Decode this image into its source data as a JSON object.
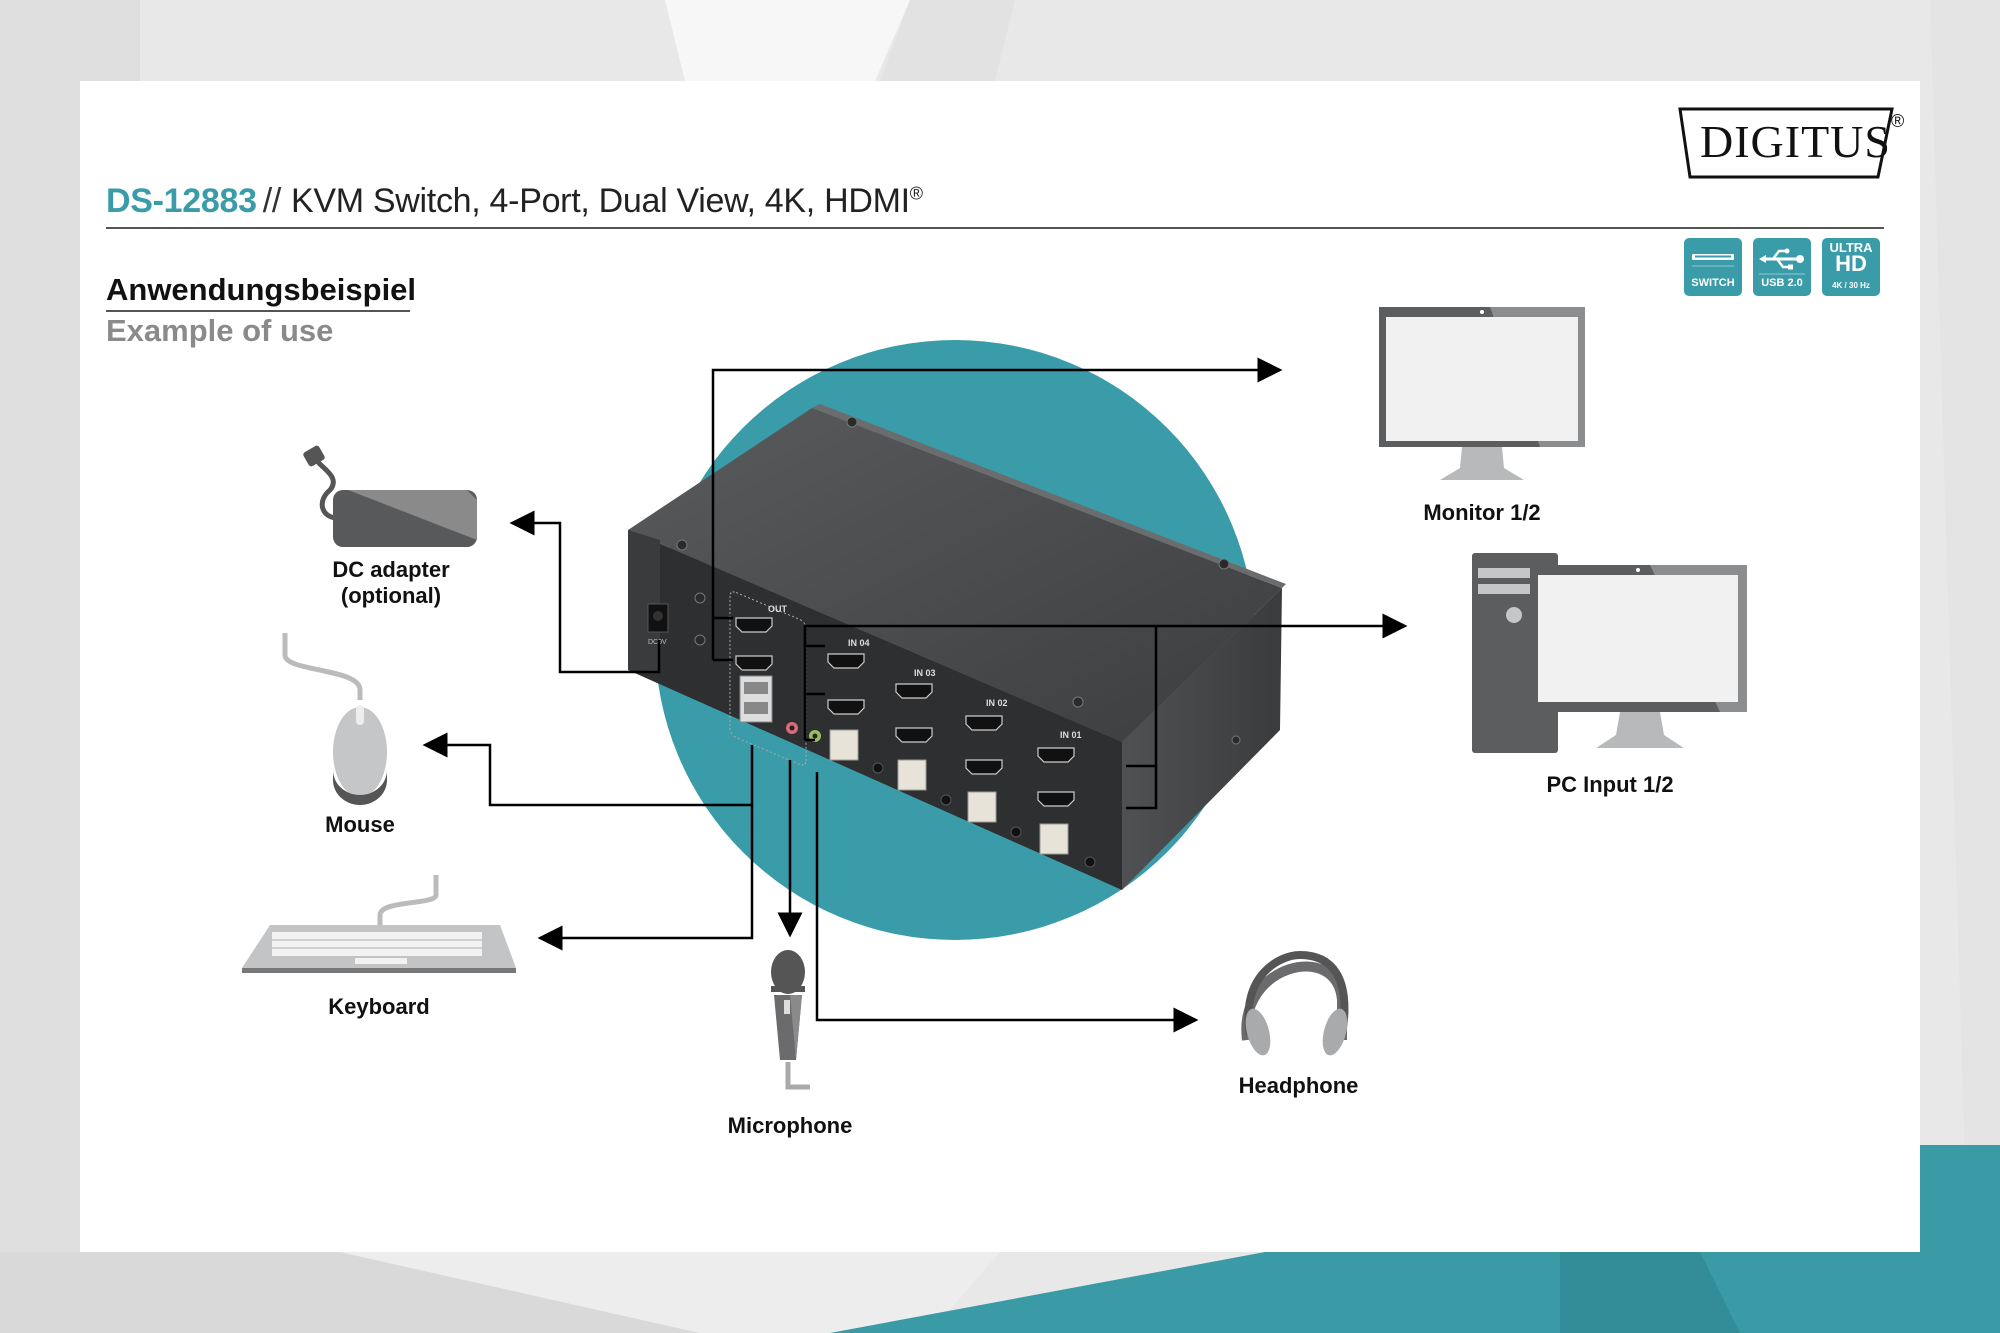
{
  "brand": {
    "logo_text": "DIGITUS",
    "logo_mark": "®",
    "accent_color": "#3a9ca8"
  },
  "header": {
    "sku": "DS-12883",
    "separator": "//",
    "product_title": "KVM Switch, 4-Port, Dual View, 4K, HDMI",
    "trademark": "®"
  },
  "badges": [
    {
      "icon": "switch-icon",
      "label": "SWITCH"
    },
    {
      "icon": "usb-icon",
      "label": "USB 2.0"
    },
    {
      "icon": "ultra-hd-icon",
      "title_top": "ULTRA",
      "title_main": "HD",
      "label": "4K / 30 Hz"
    }
  ],
  "section": {
    "heading_de": "Anwendungsbeispiel",
    "heading_en": "Example of use"
  },
  "device": {
    "port_labels": [
      "OUT",
      "IN 04",
      "IN 03",
      "IN 02",
      "IN 01"
    ],
    "power_label": "DC9V"
  },
  "devices": {
    "dc_adapter": {
      "line1": "DC adapter",
      "line2": "(optional)"
    },
    "mouse": {
      "label": "Mouse"
    },
    "keyboard": {
      "label": "Keyboard"
    },
    "microphone": {
      "label": "Microphone"
    },
    "headphone": {
      "label": "Headphone"
    },
    "monitor": {
      "label": "Monitor 1/2"
    },
    "pc_input": {
      "label": "PC Input 1/2"
    }
  }
}
